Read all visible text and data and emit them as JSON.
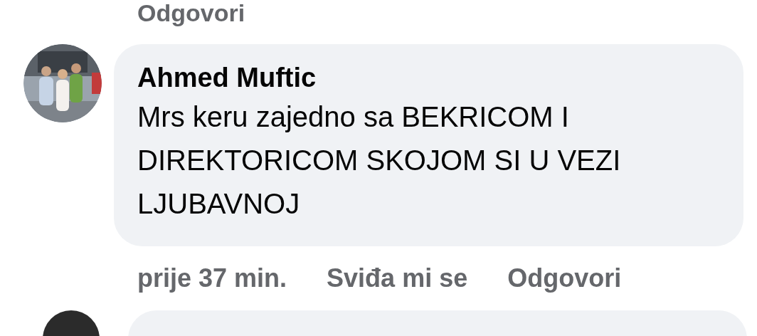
{
  "previous_comment": {
    "reply_link": "Odgovori"
  },
  "comment": {
    "author": "Ahmed Muftic",
    "text": "Mrs keru zajedno sa BEKRICOM I DIREKTORICOM SKOJOM SI U VEZI LJUBAVNOJ",
    "time": "prije 37 min.",
    "actions": [
      "Sviđa mi se",
      "Odgovori"
    ]
  }
}
